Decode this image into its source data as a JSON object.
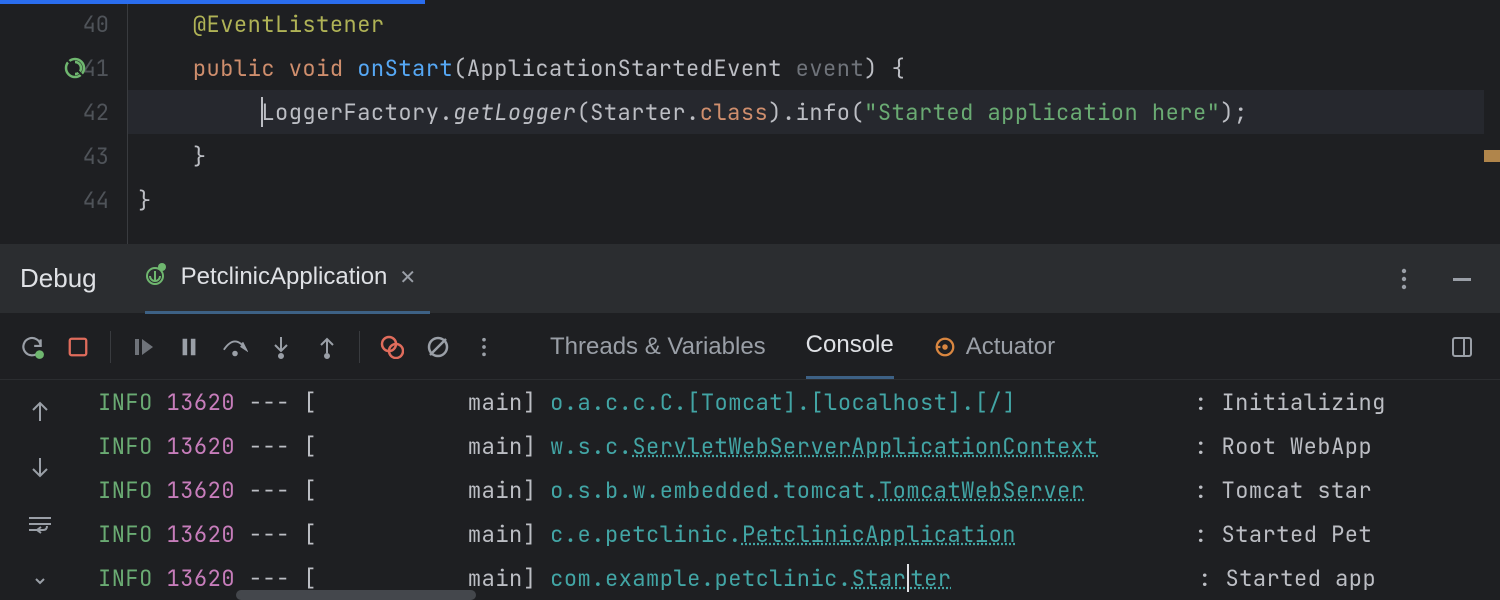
{
  "editor": {
    "lines": [
      {
        "num": "40",
        "indent": "    ",
        "tokens": [
          {
            "t": "@EventListener",
            "c": "tk-annot"
          }
        ]
      },
      {
        "num": "41",
        "indent": "    ",
        "icon": "run-gutter",
        "tokens": [
          {
            "t": "public ",
            "c": "tk-kw"
          },
          {
            "t": "void ",
            "c": "tk-kw"
          },
          {
            "t": "onStart",
            "c": "tk-method"
          },
          {
            "t": "(",
            "c": "tk-punct"
          },
          {
            "t": "ApplicationStartedEvent ",
            "c": "tk-class"
          },
          {
            "t": "event",
            "c": "tk-param"
          },
          {
            "t": ") {",
            "c": "tk-punct"
          }
        ]
      },
      {
        "num": "42",
        "indent": "         ",
        "highlight": true,
        "caret": true,
        "tokens": [
          {
            "t": "LoggerFactory",
            "c": "tk-class"
          },
          {
            "t": ".",
            "c": "tk-punct"
          },
          {
            "t": "getLogger",
            "c": "tk-italic"
          },
          {
            "t": "(Starter.",
            "c": "tk-punct"
          },
          {
            "t": "class",
            "c": "tk-kw"
          },
          {
            "t": ").info(",
            "c": "tk-punct"
          },
          {
            "t": "\"Started application here\"",
            "c": "tk-str"
          },
          {
            "t": ");",
            "c": "tk-punct"
          }
        ]
      },
      {
        "num": "43",
        "indent": "    ",
        "tokens": [
          {
            "t": "}",
            "c": "tk-punct"
          }
        ]
      },
      {
        "num": "44",
        "indent": "",
        "tokens": [
          {
            "t": "}",
            "c": "tk-punct"
          }
        ]
      }
    ]
  },
  "debugBar": {
    "title": "Debug",
    "tabLabel": "PetclinicApplication"
  },
  "toolbar": {
    "tabs": {
      "threads": "Threads & Variables",
      "console": "Console",
      "actuator": "Actuator"
    }
  },
  "console": [
    {
      "level": "INFO",
      "pid": "13620",
      "thread": "main",
      "logger": "o.a.c.c.C.[Tomcat].[localhost].[/]",
      "loggerU": "",
      "msg": "Initializing"
    },
    {
      "level": "INFO",
      "pid": "13620",
      "thread": "main",
      "logger": "w.s.c.",
      "loggerU": "ServletWebServerApplicationContext",
      "msg": "Root WebApp"
    },
    {
      "level": "INFO",
      "pid": "13620",
      "thread": "main",
      "logger": "o.s.b.w.embedded.tomcat.",
      "loggerU": "TomcatWebServer",
      "msg": "Tomcat star"
    },
    {
      "level": "INFO",
      "pid": "13620",
      "thread": "main",
      "logger": "c.e.petclinic.",
      "loggerU": "PetclinicApplication",
      "msg": "Started Pet"
    },
    {
      "level": "INFO",
      "pid": "13620",
      "thread": "main",
      "logger": "com.example.petclinic.",
      "loggerU": "Starter",
      "msg": "Started app",
      "cursor": true
    }
  ]
}
